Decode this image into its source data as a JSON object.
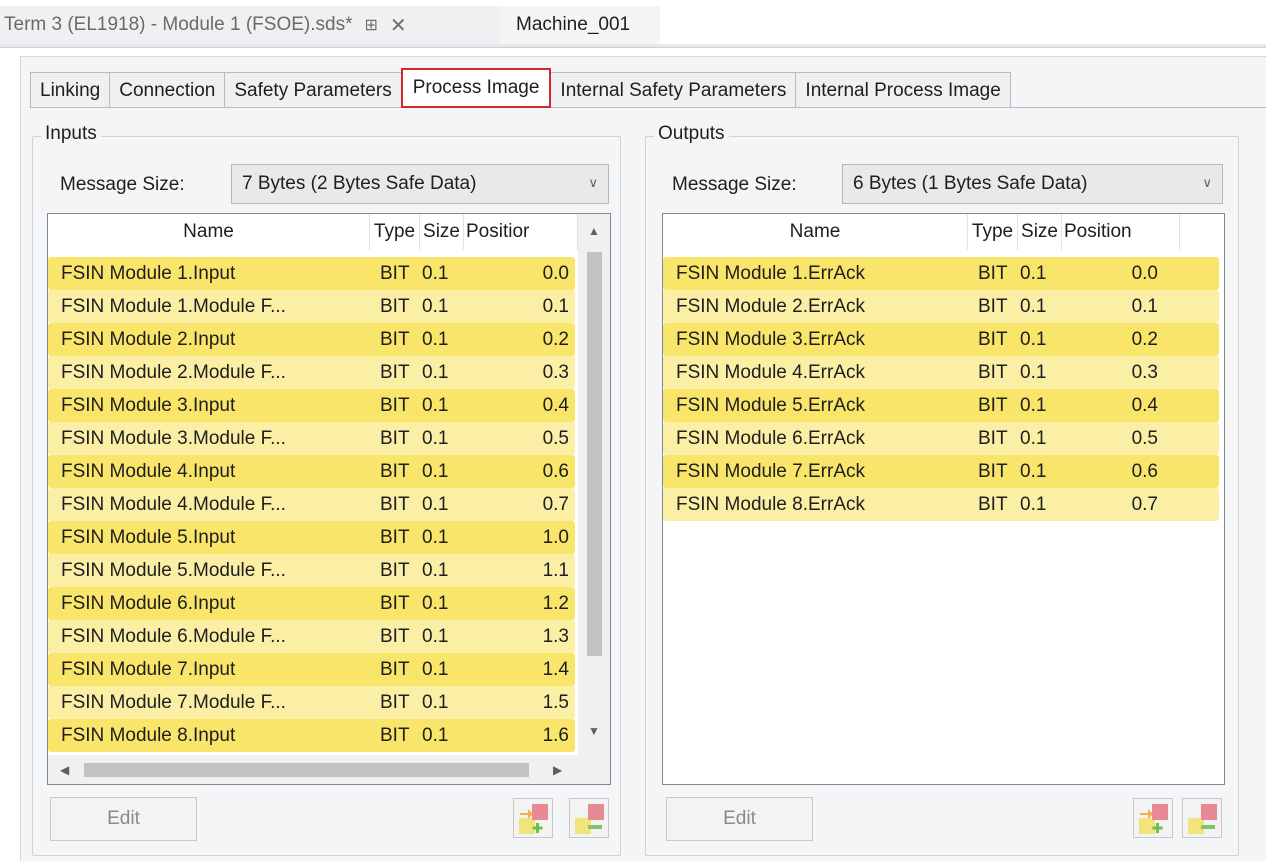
{
  "doc_tabs": {
    "active": "Term 3 (EL1918) - Module 1 (FSOE).sds*",
    "second": "Machine_001"
  },
  "tabs": [
    "Linking",
    "Connection",
    "Safety Parameters",
    "Process Image",
    "Internal Safety Parameters",
    "Internal Process Image"
  ],
  "active_tab": "Process Image",
  "inputs": {
    "title": "Inputs",
    "message_size_label": "Message Size:",
    "message_size_value": "7 Bytes (2 Bytes Safe Data)",
    "columns": [
      "Name",
      "Type",
      "Size",
      "Positior"
    ],
    "rows": [
      [
        "FSIN Module 1.Input",
        "BIT",
        "0.1",
        "0.0"
      ],
      [
        "FSIN Module 1.Module F...",
        "BIT",
        "0.1",
        "0.1"
      ],
      [
        "FSIN Module 2.Input",
        "BIT",
        "0.1",
        "0.2"
      ],
      [
        "FSIN Module 2.Module F...",
        "BIT",
        "0.1",
        "0.3"
      ],
      [
        "FSIN Module 3.Input",
        "BIT",
        "0.1",
        "0.4"
      ],
      [
        "FSIN Module 3.Module F...",
        "BIT",
        "0.1",
        "0.5"
      ],
      [
        "FSIN Module 4.Input",
        "BIT",
        "0.1",
        "0.6"
      ],
      [
        "FSIN Module 4.Module F...",
        "BIT",
        "0.1",
        "0.7"
      ],
      [
        "FSIN Module 5.Input",
        "BIT",
        "0.1",
        "1.0"
      ],
      [
        "FSIN Module 5.Module F...",
        "BIT",
        "0.1",
        "1.1"
      ],
      [
        "FSIN Module 6.Input",
        "BIT",
        "0.1",
        "1.2"
      ],
      [
        "FSIN Module 6.Module F...",
        "BIT",
        "0.1",
        "1.3"
      ],
      [
        "FSIN Module 7.Input",
        "BIT",
        "0.1",
        "1.4"
      ],
      [
        "FSIN Module 7.Module F...",
        "BIT",
        "0.1",
        "1.5"
      ],
      [
        "FSIN Module 8.Input",
        "BIT",
        "0.1",
        "1.6"
      ]
    ],
    "edit_label": "Edit"
  },
  "outputs": {
    "title": "Outputs",
    "message_size_label": "Message Size:",
    "message_size_value": "6 Bytes (1 Bytes Safe Data)",
    "columns": [
      "Name",
      "Type",
      "Size",
      "Position"
    ],
    "rows": [
      [
        "FSIN Module 1.ErrAck",
        "BIT",
        "0.1",
        "0.0"
      ],
      [
        "FSIN Module 2.ErrAck",
        "BIT",
        "0.1",
        "0.1"
      ],
      [
        "FSIN Module 3.ErrAck",
        "BIT",
        "0.1",
        "0.2"
      ],
      [
        "FSIN Module 4.ErrAck",
        "BIT",
        "0.1",
        "0.3"
      ],
      [
        "FSIN Module 5.ErrAck",
        "BIT",
        "0.1",
        "0.4"
      ],
      [
        "FSIN Module 6.ErrAck",
        "BIT",
        "0.1",
        "0.5"
      ],
      [
        "FSIN Module 7.ErrAck",
        "BIT",
        "0.1",
        "0.6"
      ],
      [
        "FSIN Module 8.ErrAck",
        "BIT",
        "0.1",
        "0.7"
      ]
    ],
    "edit_label": "Edit"
  },
  "colors": {
    "row_highlight": "#f9e56a",
    "row_light": "#fbefa6",
    "active_tab_border": "#d4262b"
  },
  "icons": {
    "pin": "pin-icon",
    "close": "close-icon",
    "combo_arrow": "chevron-down-icon",
    "add_variable": "add-variable-icon",
    "remove_variable": "remove-variable-icon"
  }
}
